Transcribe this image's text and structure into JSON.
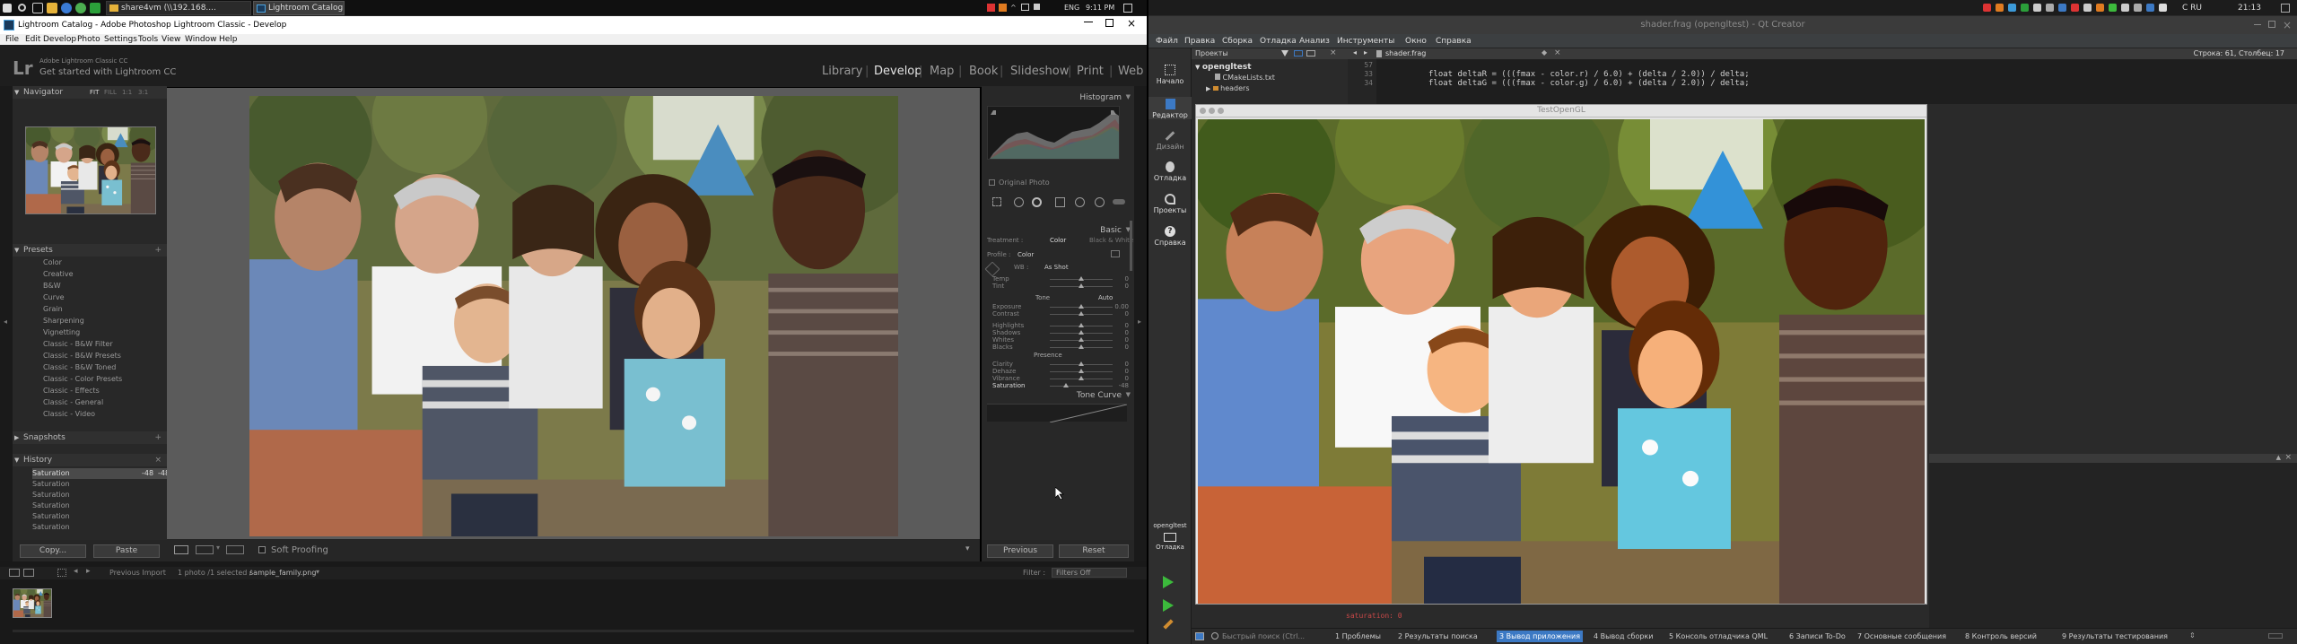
{
  "taskbar_left": {
    "windows": [
      "share4vm (\\\\192.168....",
      "Lightroom Catalog - ..."
    ],
    "tray": {
      "lang": "ENG",
      "time": "9:11 PM"
    }
  },
  "lightroom": {
    "window_title": "Lightroom Catalog - Adobe Photoshop Lightroom Classic - Develop",
    "menu": [
      "File",
      "Edit",
      "Develop",
      "Photo",
      "Settings",
      "Tools",
      "View",
      "Window",
      "Help"
    ],
    "identity": {
      "brand": "Adobe Lightroom Classic CC",
      "tagline": "Get started with Lightroom CC"
    },
    "modules": [
      "Library",
      "Develop",
      "Map",
      "Book",
      "Slideshow",
      "Print",
      "Web"
    ],
    "selected_module": "Develop",
    "navigator": {
      "title": "Navigator",
      "options": [
        "FIT",
        "FILL",
        "1:1",
        "3:1"
      ]
    },
    "presets": {
      "title": "Presets",
      "items": [
        "Color",
        "Creative",
        "B&W",
        "Curve",
        "Grain",
        "Sharpening",
        "Vignetting",
        "Classic - B&W Filter",
        "Classic - B&W Presets",
        "Classic - B&W Toned",
        "Classic - Color Presets",
        "Classic - Effects",
        "Classic - General",
        "Classic - Video"
      ]
    },
    "snapshots": {
      "title": "Snapshots"
    },
    "history": {
      "title": "History",
      "rows": [
        {
          "label": "Saturation",
          "a": "-48",
          "b": "-48"
        },
        {
          "label": "Saturation",
          "a": "",
          "b": ""
        },
        {
          "label": "Saturation",
          "a": "",
          "b": ""
        },
        {
          "label": "Saturation",
          "a": "",
          "b": ""
        },
        {
          "label": "Saturation",
          "a": "",
          "b": ""
        },
        {
          "label": "Saturation",
          "a": "",
          "b": ""
        }
      ]
    },
    "copy_label": "Copy...",
    "paste_label": "Paste",
    "toolbar": {
      "soft_proofing": "Soft Proofing"
    },
    "histogram": {
      "title": "Histogram",
      "original_photo": "Original Photo"
    },
    "basic": {
      "title": "Basic",
      "treatment_label": "Treatment :",
      "treatment_options": [
        "Color",
        "Black & White"
      ],
      "profile_label": "Profile :",
      "profile_value": "Color",
      "wb_label": "WB :",
      "wb_value": "As Shot",
      "tone_label": "Tone",
      "auto_label": "Auto",
      "presence_label": "Presence",
      "sliders": [
        {
          "label": "Temp",
          "value": "0",
          "pos": 0.5
        },
        {
          "label": "Tint",
          "value": "0",
          "pos": 0.5
        },
        {
          "label": "Exposure",
          "value": "0.00",
          "pos": 0.5
        },
        {
          "label": "Contrast",
          "value": "0",
          "pos": 0.5
        },
        {
          "label": "Highlights",
          "value": "0",
          "pos": 0.5
        },
        {
          "label": "Shadows",
          "value": "0",
          "pos": 0.5
        },
        {
          "label": "Whites",
          "value": "0",
          "pos": 0.5
        },
        {
          "label": "Blacks",
          "value": "0",
          "pos": 0.5
        },
        {
          "label": "Clarity",
          "value": "0",
          "pos": 0.5
        },
        {
          "label": "Dehaze",
          "value": "0",
          "pos": 0.5
        },
        {
          "label": "Vibrance",
          "value": "0",
          "pos": 0.5
        },
        {
          "label": "Saturation",
          "value": "-48",
          "pos": 0.26
        }
      ]
    },
    "tone_curve": {
      "title": "Tone Curve"
    },
    "previous_label": "Previous",
    "reset_label": "Reset",
    "filmstrip": {
      "previous_import": "Previous Import",
      "count_text": "1 photo /1 selected /",
      "filename": "sample_family.png",
      "filter_label": "Filter :",
      "filter_value": "Filters Off"
    }
  },
  "taskbar_right": {
    "lang": "C RU",
    "time": "21:13"
  },
  "qt": {
    "window_title": "shader.frag (opengltest) - Qt Creator",
    "menu": [
      "Файл",
      "Правка",
      "Сборка",
      "Отладка",
      "Анализ",
      "Инструменты",
      "Окно",
      "Справка"
    ],
    "modes": [
      "Начало",
      "Редактор",
      "Дизайн",
      "Отладка",
      "Проекты",
      "Справка"
    ],
    "project_header": "Проекты",
    "project_tree": [
      "opengltest",
      "CMakeLists.txt",
      "headers"
    ],
    "editor_file": "shader.frag",
    "cursor_pos": "Строка: 61, Столбец: 17",
    "code_lines": [
      {
        "num": "57",
        "text": ""
      },
      {
        "num": "33",
        "text": "float deltaR = (((fmax - color.r) / 6.0) + (delta / 2.0)) / delta;"
      },
      {
        "num": "34",
        "text": "float deltaG = (((fmax - color.g) / 6.0) + (delta / 2.0)) / delta;"
      }
    ],
    "gl_window_title": "TestOpenGL",
    "output_text": "saturation: 0",
    "kit_name": "opengltest",
    "kit_config": "Отладка",
    "locator_placeholder": "Быстрый поиск (Ctrl...",
    "status_tabs": [
      "1 Проблемы",
      "2 Результаты поиска",
      "3 Вывод приложения",
      "4 Вывод сборки",
      "5 Консоль отладчика QML",
      "6 Записи To-Do",
      "7 Основные сообщения",
      "8 Контроль версий",
      "9 Результаты тестирования"
    ]
  }
}
